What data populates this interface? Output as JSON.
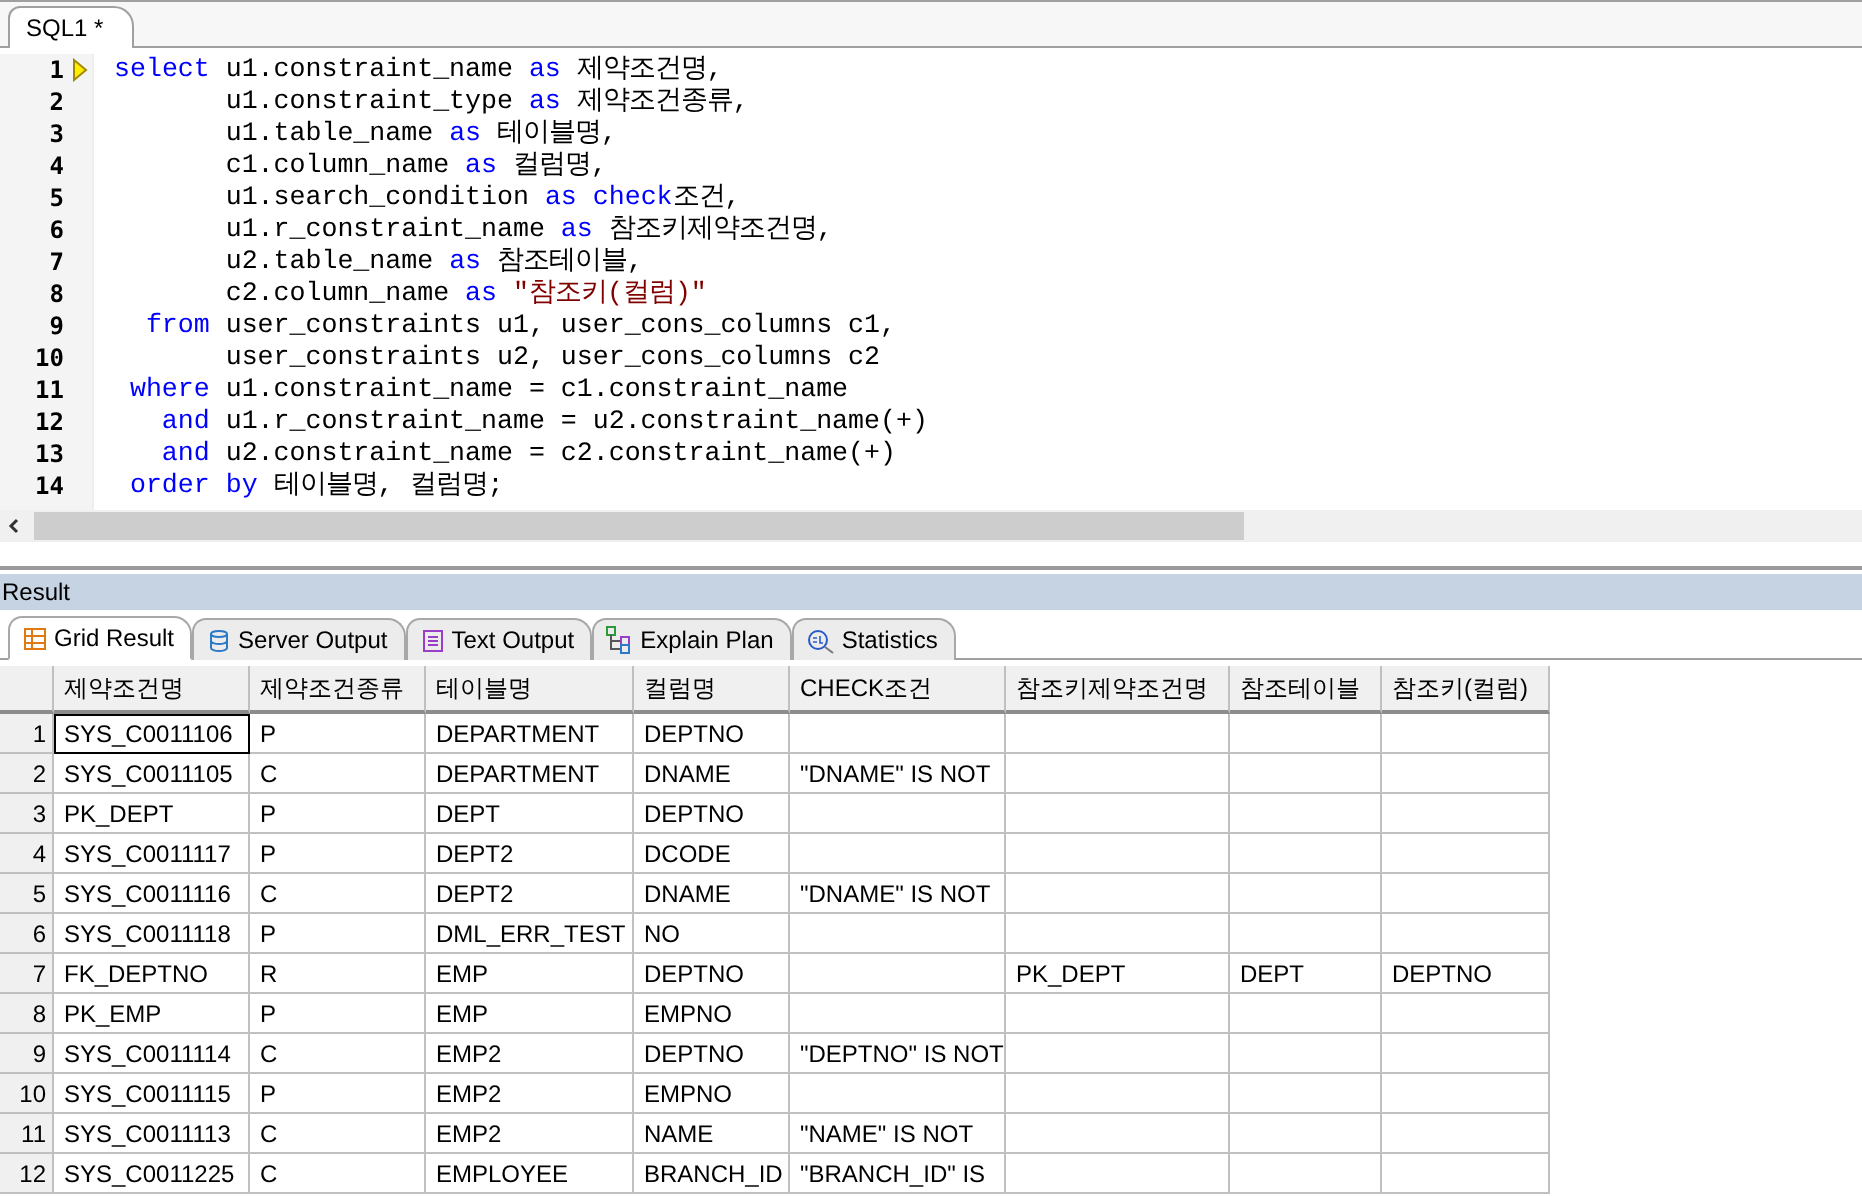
{
  "editor_tabs": [
    {
      "label": "SQL1 *",
      "selected": true
    }
  ],
  "editor": {
    "lines": [
      {
        "number": "1",
        "current": true,
        "lead": "select",
        "segments": [
          {
            "kind": "plain",
            "text": "u1.constraint_name "
          },
          {
            "kind": "keyword",
            "text": "as"
          },
          {
            "kind": "plain",
            "text": " 제약조건명,"
          }
        ]
      },
      {
        "number": "2",
        "current": false,
        "segments": [
          {
            "kind": "plain",
            "text": "u1.constraint_type "
          },
          {
            "kind": "keyword",
            "text": "as"
          },
          {
            "kind": "plain",
            "text": " 제약조건종류,"
          }
        ]
      },
      {
        "number": "3",
        "current": false,
        "segments": [
          {
            "kind": "plain",
            "text": "u1.table_name "
          },
          {
            "kind": "keyword",
            "text": "as"
          },
          {
            "kind": "plain",
            "text": " 테이블명,"
          }
        ]
      },
      {
        "number": "4",
        "current": false,
        "segments": [
          {
            "kind": "plain",
            "text": "c1.column_name "
          },
          {
            "kind": "keyword",
            "text": "as"
          },
          {
            "kind": "plain",
            "text": " 컬럼명,"
          }
        ]
      },
      {
        "number": "5",
        "current": false,
        "segments": [
          {
            "kind": "plain",
            "text": "u1.search_condition "
          },
          {
            "kind": "keyword",
            "text": "as check"
          },
          {
            "kind": "plain",
            "text": "조건,"
          }
        ]
      },
      {
        "number": "6",
        "current": false,
        "segments": [
          {
            "kind": "plain",
            "text": "u1.r_constraint_name "
          },
          {
            "kind": "keyword",
            "text": "as"
          },
          {
            "kind": "plain",
            "text": " 참조키제약조건명,"
          }
        ]
      },
      {
        "number": "7",
        "current": false,
        "segments": [
          {
            "kind": "plain",
            "text": "u2.table_name "
          },
          {
            "kind": "keyword",
            "text": "as"
          },
          {
            "kind": "plain",
            "text": " 참조테이블,"
          }
        ]
      },
      {
        "number": "8",
        "current": false,
        "segments": [
          {
            "kind": "plain",
            "text": "c2.column_name "
          },
          {
            "kind": "keyword",
            "text": "as"
          },
          {
            "kind": "string",
            "text": " \"참조키(컬럼)\""
          }
        ]
      },
      {
        "number": "9",
        "current": false,
        "lead": "from",
        "segments": [
          {
            "kind": "plain",
            "text": "user_constraints u1, user_cons_columns c1,"
          }
        ]
      },
      {
        "number": "10",
        "current": false,
        "segments": [
          {
            "kind": "plain",
            "text": "user_constraints u2, user_cons_columns c2"
          }
        ]
      },
      {
        "number": "11",
        "current": false,
        "lead": "where",
        "segments": [
          {
            "kind": "plain",
            "text": "u1.constraint_name = c1.constraint_name"
          }
        ]
      },
      {
        "number": "12",
        "current": false,
        "lead": "and",
        "segments": [
          {
            "kind": "plain",
            "text": "u1.r_constraint_name = u2.constraint_name(+)"
          }
        ]
      },
      {
        "number": "13",
        "current": false,
        "lead": "and",
        "segments": [
          {
            "kind": "plain",
            "text": "u2.constraint_name = c2.constraint_name(+)"
          }
        ]
      },
      {
        "number": "14",
        "current": false,
        "lead": "order",
        "segments": [
          {
            "kind": "keyword",
            "text": "by"
          },
          {
            "kind": "plain",
            "text": " 테이블명, 컬럼명;"
          }
        ]
      }
    ]
  },
  "result_panel": {
    "title": "Result",
    "tabs": [
      {
        "label": "Grid Result",
        "kind": "grid",
        "selected": true
      },
      {
        "label": "Server Output",
        "kind": "server",
        "selected": false
      },
      {
        "label": "Text Output",
        "kind": "text",
        "selected": false
      },
      {
        "label": "Explain Plan",
        "kind": "plan",
        "selected": false
      },
      {
        "label": "Statistics",
        "kind": "stats",
        "selected": false
      }
    ],
    "grid": {
      "columns": [
        "제약조건명",
        "제약조건종류",
        "테이블명",
        "컬럼명",
        "CHECK조건",
        "참조키제약조건명",
        "참조테이블",
        "참조키(컬럼)"
      ],
      "rows": [
        {
          "number": "1",
          "selected": true,
          "cells": [
            "SYS_C0011106",
            "P",
            "DEPARTMENT",
            "DEPTNO",
            "",
            "",
            "",
            ""
          ]
        },
        {
          "number": "2",
          "selected": false,
          "cells": [
            "SYS_C0011105",
            "C",
            "DEPARTMENT",
            "DNAME",
            "\"DNAME\" IS NOT",
            "",
            "",
            ""
          ]
        },
        {
          "number": "3",
          "selected": false,
          "cells": [
            "PK_DEPT",
            "P",
            "DEPT",
            "DEPTNO",
            "",
            "",
            "",
            ""
          ]
        },
        {
          "number": "4",
          "selected": false,
          "cells": [
            "SYS_C0011117",
            "P",
            "DEPT2",
            "DCODE",
            "",
            "",
            "",
            ""
          ]
        },
        {
          "number": "5",
          "selected": false,
          "cells": [
            "SYS_C0011116",
            "C",
            "DEPT2",
            "DNAME",
            "\"DNAME\" IS NOT",
            "",
            "",
            ""
          ]
        },
        {
          "number": "6",
          "selected": false,
          "cells": [
            "SYS_C0011118",
            "P",
            "DML_ERR_TEST",
            "NO",
            "",
            "",
            "",
            ""
          ]
        },
        {
          "number": "7",
          "selected": false,
          "cells": [
            "FK_DEPTNO",
            "R",
            "EMP",
            "DEPTNO",
            "",
            "PK_DEPT",
            "DEPT",
            "DEPTNO"
          ]
        },
        {
          "number": "8",
          "selected": false,
          "cells": [
            "PK_EMP",
            "P",
            "EMP",
            "EMPNO",
            "",
            "",
            "",
            ""
          ]
        },
        {
          "number": "9",
          "selected": false,
          "cells": [
            "SYS_C0011114",
            "C",
            "EMP2",
            "DEPTNO",
            "\"DEPTNO\" IS NOT",
            "",
            "",
            ""
          ]
        },
        {
          "number": "10",
          "selected": false,
          "cells": [
            "SYS_C0011115",
            "P",
            "EMP2",
            "EMPNO",
            "",
            "",
            "",
            ""
          ]
        },
        {
          "number": "11",
          "selected": false,
          "cells": [
            "SYS_C0011113",
            "C",
            "EMP2",
            "NAME",
            "\"NAME\" IS NOT",
            "",
            "",
            ""
          ]
        },
        {
          "number": "12",
          "selected": false,
          "cells": [
            "SYS_C0011225",
            "C",
            "EMPLOYEE",
            "BRANCH_ID",
            "\"BRANCH_ID\" IS",
            "",
            "",
            ""
          ]
        }
      ]
    }
  }
}
